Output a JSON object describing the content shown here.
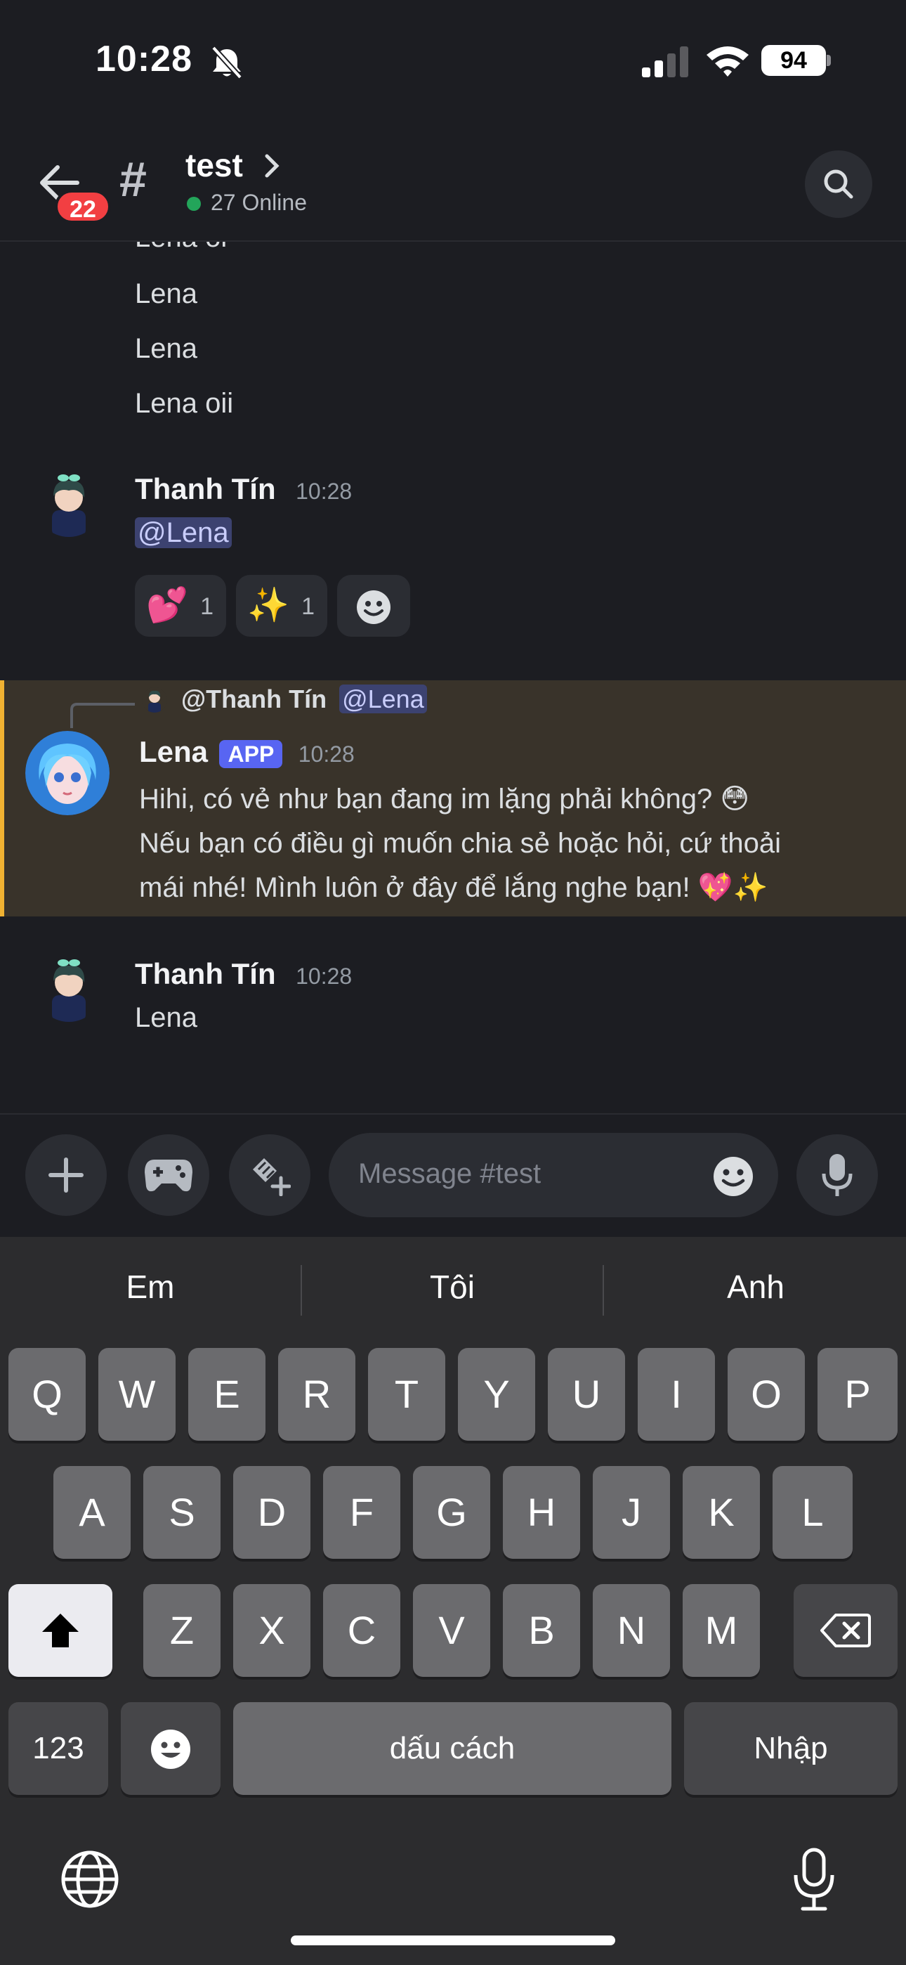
{
  "status_bar": {
    "time": "10:28",
    "battery": "94"
  },
  "header": {
    "badge_count": "22",
    "channel_name": "test",
    "online_text": "27 Online"
  },
  "messages": {
    "prev_lines": [
      "Lena oi",
      "Lena",
      "Lena",
      "Lena oii"
    ],
    "m1": {
      "author": "Thanh Tín",
      "time": "10:28",
      "mention": "@Lena",
      "reactions": [
        {
          "emoji": "💕",
          "count": "1"
        },
        {
          "emoji": "✨",
          "count": "1"
        }
      ]
    },
    "reply": {
      "ref_author": "@Thanh Tín",
      "ref_mention": "@Lena",
      "author": "Lena",
      "tag": "APP",
      "time": "10:28",
      "lines": [
        "Hihi, có vẻ như bạn đang im lặng phải không? 😳",
        "Nếu bạn có điều gì muốn chia sẻ hoặc hỏi, cứ thoải",
        "mái nhé! Mình luôn ở đây để lắng nghe bạn! 💖✨"
      ]
    },
    "m3": {
      "author": "Thanh Tín",
      "time": "10:28",
      "text": "Lena"
    }
  },
  "composer": {
    "placeholder": "Message #test"
  },
  "keyboard": {
    "suggestions": [
      "Em",
      "Tôi",
      "Anh"
    ],
    "row1": [
      "Q",
      "W",
      "E",
      "R",
      "T",
      "Y",
      "U",
      "I",
      "O",
      "P"
    ],
    "row2": [
      "A",
      "S",
      "D",
      "F",
      "G",
      "H",
      "J",
      "K",
      "L"
    ],
    "row3": [
      "Z",
      "X",
      "C",
      "V",
      "B",
      "N",
      "M"
    ],
    "numbers": "123",
    "space": "dấu cách",
    "enter": "Nhập"
  }
}
